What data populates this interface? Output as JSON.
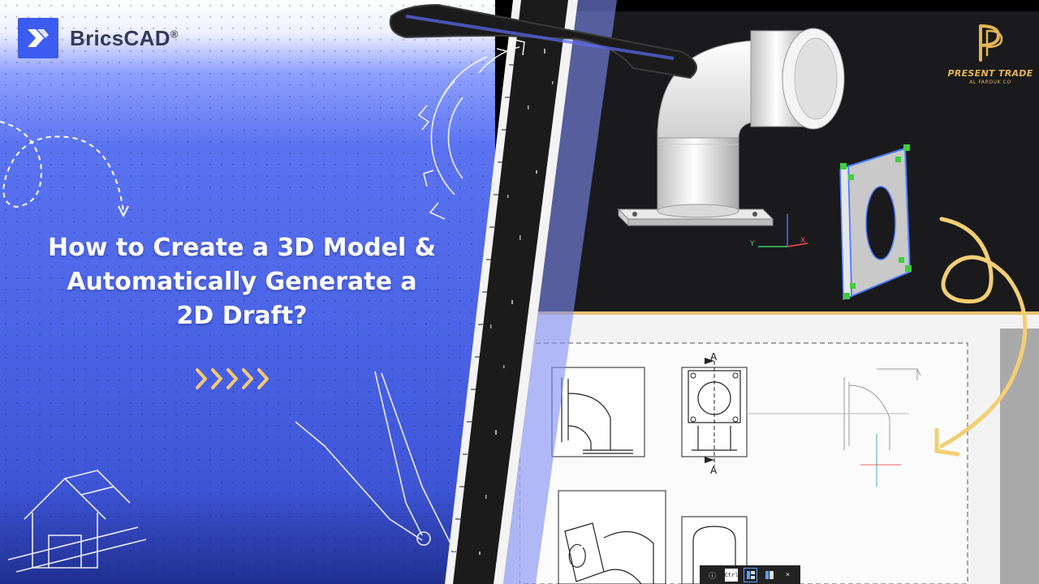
{
  "brand": {
    "name": "BricsCAD",
    "mark": "®"
  },
  "headline": {
    "line1": "How to Create a 3D Model &",
    "line2": "Automatically Generate a",
    "line3": "2D Draft?"
  },
  "chevron_count": 5,
  "partner": {
    "name": "PRESENT TRADE",
    "sub": "AL FAROUK CO"
  },
  "drawing": {
    "section_top": "A",
    "section_bottom": "A"
  },
  "viewport": {
    "axis_y": "Y",
    "axis_x": "X"
  },
  "toolbar": {
    "ctrl_label": "Ctrl",
    "close": "×",
    "info": "ⓘ"
  },
  "colors": {
    "brand_blue": "#3c5bf0",
    "accent_gold": "#e9c272",
    "panel_blue": "#4a63e6",
    "cad_dark": "#1a1a1c"
  }
}
